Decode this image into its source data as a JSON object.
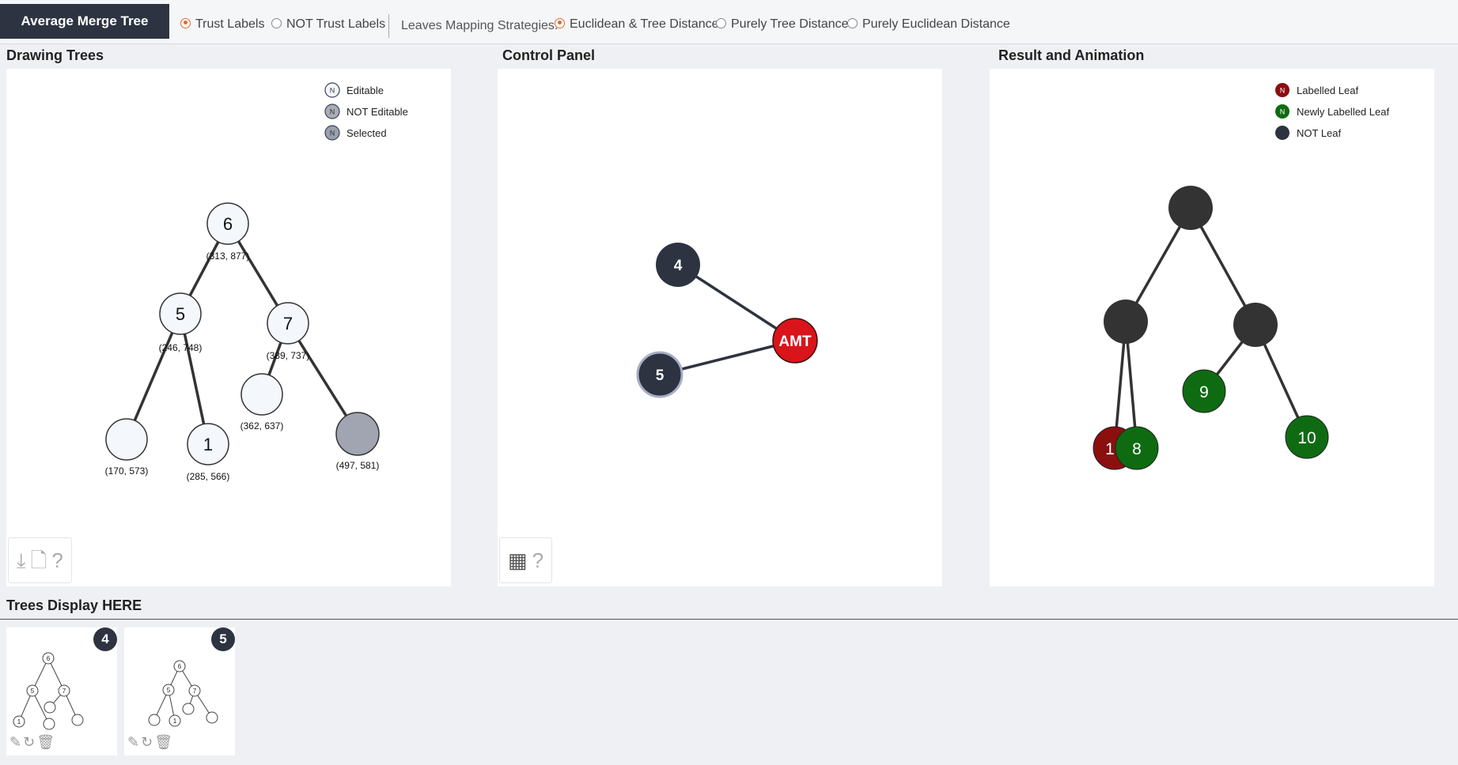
{
  "app": {
    "title": "Average Merge Tree"
  },
  "toolbar": {
    "labels_mode": {
      "options": [
        {
          "label": "Trust Labels",
          "selected": true
        },
        {
          "label": "NOT Trust Labels",
          "selected": false
        }
      ]
    },
    "mapping": {
      "label": "Leaves Mapping Strategies:",
      "options": [
        {
          "label": "Euclidean & Tree Distance",
          "selected": true
        },
        {
          "label": "Purely Tree Distance",
          "selected": false
        },
        {
          "label": "Purely Euclidean Distance",
          "selected": false
        }
      ]
    }
  },
  "panels": {
    "drawing": {
      "title": "Drawing Trees",
      "legend": [
        {
          "glyph": "N",
          "label": "Editable",
          "fill": "#f4f7fb"
        },
        {
          "glyph": "N",
          "label": "NOT Editable",
          "fill": "#a9adb8"
        },
        {
          "glyph": "N",
          "label": "Selected",
          "fill": "#9aa0ad"
        }
      ],
      "nodes": [
        {
          "label": "6",
          "coord": "(313, 877)"
        },
        {
          "label": "5",
          "coord": "(246, 748)"
        },
        {
          "label": "7",
          "coord": "(389, 737)"
        },
        {
          "label": "",
          "coord": "(362, 637)"
        },
        {
          "label": "",
          "coord": "(497, 581)"
        },
        {
          "label": "",
          "coord": "(170, 573)"
        },
        {
          "label": "1",
          "coord": "(285, 566)"
        }
      ]
    },
    "control": {
      "title": "Control Panel",
      "nodes": [
        {
          "label": "4"
        },
        {
          "label": "5"
        },
        {
          "label": "AMT"
        }
      ]
    },
    "result": {
      "title": "Result and Animation",
      "legend": [
        {
          "glyph": "N",
          "label": "Labelled Leaf",
          "fill": "#8b0f0f"
        },
        {
          "glyph": "N",
          "label": "Newly Labelled Leaf",
          "fill": "#0f6b12"
        },
        {
          "glyph": "",
          "label": "NOT Leaf",
          "fill": "#2d3340"
        }
      ],
      "nodes": [
        {
          "label": "1"
        },
        {
          "label": "8"
        },
        {
          "label": "9"
        },
        {
          "label": "10"
        }
      ]
    }
  },
  "display": {
    "title": "Trees Display HERE",
    "thumbs": [
      {
        "badge": "4",
        "labels": [
          "6",
          "5",
          "7",
          "1"
        ]
      },
      {
        "badge": "5",
        "labels": [
          "6",
          "5",
          "7",
          "1"
        ]
      }
    ]
  },
  "colors": {
    "accent": "#e2672d",
    "dark": "#2d3340",
    "amt_red": "#d9141b",
    "labelled_leaf": "#8b0f0f",
    "new_leaf": "#0f6b12"
  }
}
